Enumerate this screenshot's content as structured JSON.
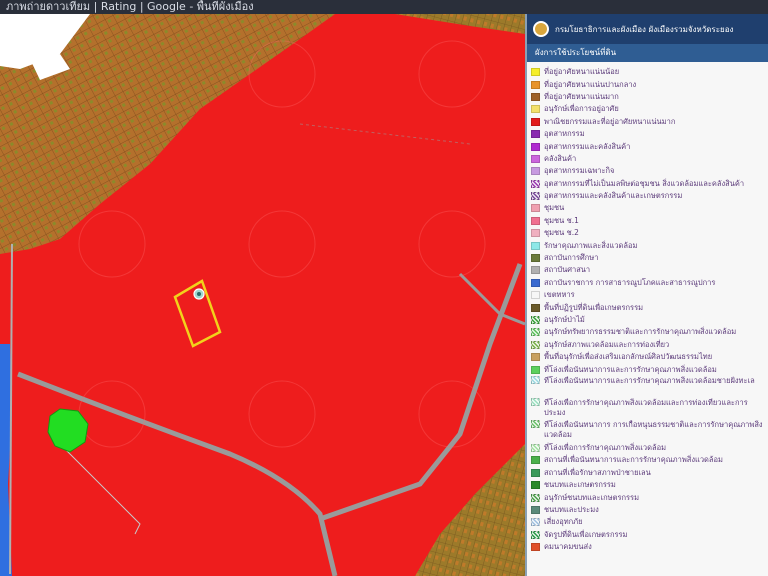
{
  "map": {
    "colors": {
      "landuse_red": "#ee1d1d",
      "residential_brown": "#b4702c",
      "rural_olive": "#8c8a2a",
      "road": "#9a9a9a",
      "green_area": "#22dd22",
      "water_blue": "#2f6fe0",
      "boundary_yellow": "#f2d21b",
      "marker": "#9fd8d0"
    },
    "icons": [
      "location-marker-icon"
    ]
  },
  "legend": {
    "title": "กรมโยธาธิการและผังเมือง ผังเมืองรวมจังหวัดระยอง",
    "subtitle": "ผังการใช้ประโยชน์ที่ดิน",
    "items": [
      {
        "label": "ที่อยู่อาศัยหนาแน่นน้อย",
        "color": "#f5ee2a",
        "hatch": false
      },
      {
        "label": "ที่อยู่อาศัยหนาแน่นปานกลาง",
        "color": "#e8932a",
        "hatch": false
      },
      {
        "label": "ที่อยู่อาศัยหนาแน่นมาก",
        "color": "#9e6128",
        "hatch": false
      },
      {
        "label": "อนุรักษ์เพื่อการอยู่อาศัย",
        "color": "#f3e06a",
        "hatch": false
      },
      {
        "label": "พาณิชยกรรมและที่อยู่อาศัยหนาแน่นมาก",
        "color": "#e21b1b",
        "hatch": false
      },
      {
        "label": "อุตสาหกรรม",
        "color": "#8a2ab0",
        "hatch": false
      },
      {
        "label": "อุตสาหกรรมและคลังสินค้า",
        "color": "#b02ad0",
        "hatch": false
      },
      {
        "label": "คลังสินค้า",
        "color": "#cc66dd",
        "hatch": false
      },
      {
        "label": "อุตสาหกรรมเฉพาะกิจ",
        "color": "#c79ae0",
        "hatch": false
      },
      {
        "label": "อุตสาหกรรมที่ไม่เป็นมลพิษต่อชุมชน สิ่งแวดล้อมและคลังสินค้า",
        "color": "#9a3ab0",
        "hatch": true
      },
      {
        "label": "อุตสาหกรรมและคลังสินค้าและเกษตรกรรม",
        "color": "#7a4a9a",
        "hatch": true
      },
      {
        "label": "ชุมชน",
        "color": "#f0a0b0",
        "hatch": false
      },
      {
        "label": "ชุมชน ช.1",
        "color": "#f07090",
        "hatch": false
      },
      {
        "label": "ชุมชน ช.2",
        "color": "#f0b0c0",
        "hatch": false
      },
      {
        "label": "รักษาคุณภาพและสิ่งแวดล้อม",
        "color": "#8ee8e8",
        "hatch": false
      },
      {
        "label": "สถาบันการศึกษา",
        "color": "#6a7a3a",
        "hatch": false
      },
      {
        "label": "สถาบันศาสนา",
        "color": "#b0b0b0",
        "hatch": false
      },
      {
        "label": "สถาบันราชการ การสาธารณูปโภคและสาธารณูปการ",
        "color": "#3a6ad0",
        "hatch": false
      },
      {
        "label": "เขตทหาร",
        "color": "#f7f7f7",
        "hatch": false
      },
      {
        "label": "พื้นที่ปฏิรูปที่ดินเพื่อเกษตรกรรม",
        "color": "#6a5a2a",
        "hatch": false
      },
      {
        "label": "อนุรักษ์ป่าไม้",
        "color": "#3aa03a",
        "hatch": true
      },
      {
        "label": "อนุรักษ์ทรัพยากรธรรมชาติและการรักษาคุณภาพสิ่งแวดล้อม",
        "color": "#5ac05a",
        "hatch": true
      },
      {
        "label": "อนุรักษ์สภาพแวดล้อมและการท่องเที่ยว",
        "color": "#7ab04a",
        "hatch": true
      },
      {
        "label": "พื้นที่อนุรักษ์เพื่อส่งเสริมเอกลักษณ์ศิลปวัฒนธรรมไทย",
        "color": "#c8a060",
        "hatch": false
      },
      {
        "label": "ที่โล่งเพื่อนันทนาการและการรักษาคุณภาพสิ่งแวดล้อม",
        "color": "#5cd05c",
        "hatch": false
      },
      {
        "label": "ที่โล่งเพื่อนันทนาการและการรักษาคุณภาพสิ่งแวดล้อมชายฝั่งทะเล",
        "color": "#9ad8e0",
        "hatch": true
      },
      {
        "label": "ที่โล่งเพื่อการรักษาคุณภาพสิ่งแวดล้อมและการท่องเที่ยวและการประมง",
        "color": "#9ae0c0",
        "hatch": true
      },
      {
        "label": "ที่โล่งเพื่อนันทนาการ การเกื้อหนุนธรรมชาติและการรักษาคุณภาพสิ่งแวดล้อม",
        "color": "#6ac06a",
        "hatch": true
      },
      {
        "label": "ที่โล่งเพื่อการรักษาคุณภาพสิ่งแวดล้อม",
        "color": "#a0e0a0",
        "hatch": true
      },
      {
        "label": "สถานที่เพื่อนันทนาการและการรักษาคุณภาพสิ่งแวดล้อม",
        "color": "#4ab04a",
        "hatch": false
      },
      {
        "label": "สถานที่เพื่อรักษาสภาพป่าชายเลน",
        "color": "#3a9a5a",
        "hatch": false
      },
      {
        "label": "ชนบทและเกษตรกรรม",
        "color": "#2a8a2a",
        "hatch": false
      },
      {
        "label": "อนุรักษ์ชนบทและเกษตรกรรม",
        "color": "#4aa04a",
        "hatch": true
      },
      {
        "label": "ชนบทและประมง",
        "color": "#5a8a7a",
        "hatch": false
      },
      {
        "label": "เสี่ยงอุทกภัย",
        "color": "#a0c0e0",
        "hatch": true
      },
      {
        "label": "จัดรูปที่ดินเพื่อเกษตรกรรม",
        "color": "#2a9a4a",
        "hatch": true
      },
      {
        "label": "คมนาคมขนส่ง",
        "color": "#e0502a",
        "hatch": false
      }
    ]
  },
  "topbar": {
    "text": "ภาพถ่ายดาวเทียม | Rating | Google - พื้นที่ผังเมือง"
  }
}
